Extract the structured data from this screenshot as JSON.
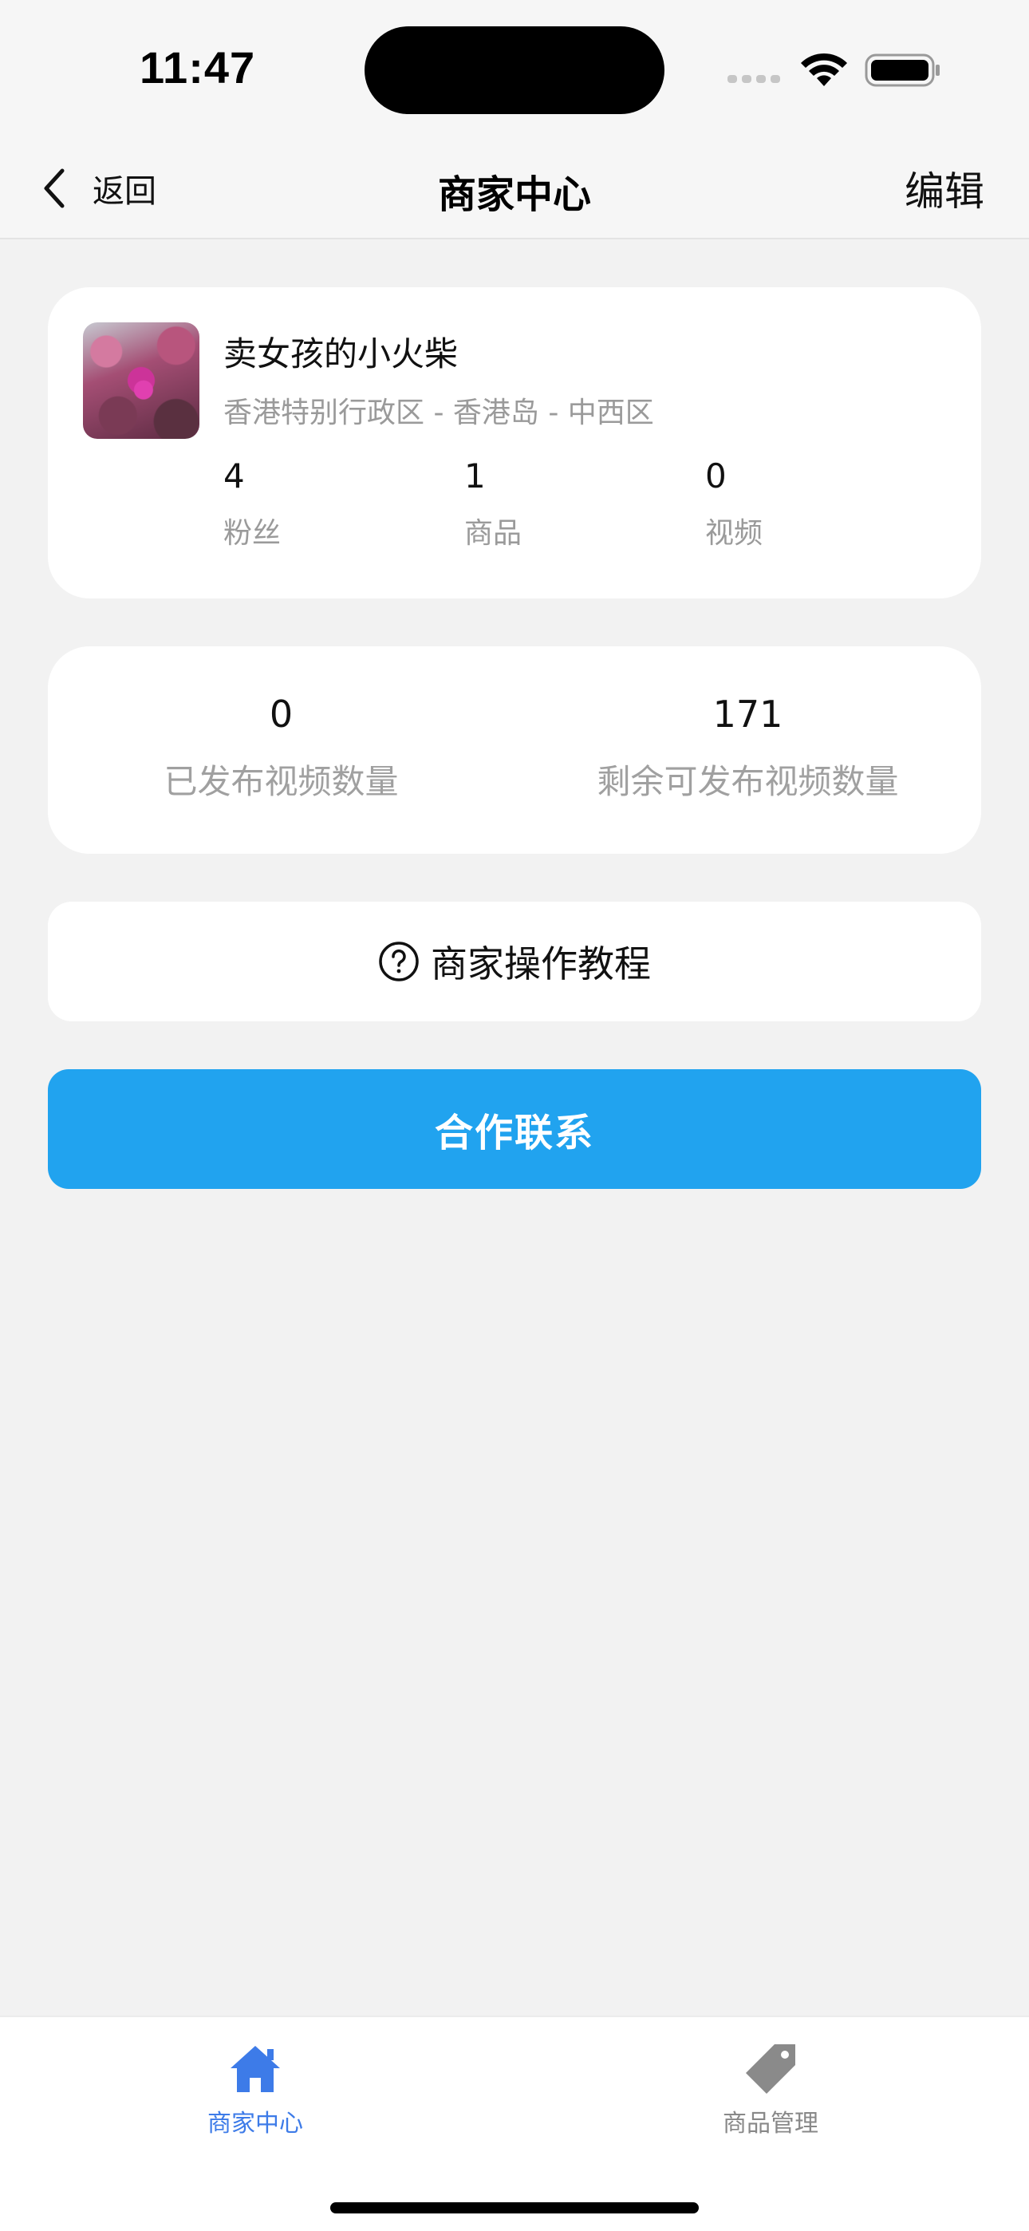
{
  "status_bar": {
    "time": "11:47"
  },
  "nav": {
    "back_label": "返回",
    "title": "商家中心",
    "edit_label": "编辑"
  },
  "profile": {
    "name": "卖女孩的小火柴",
    "location": "香港特别行政区 - 香港岛 - 中西区",
    "stats": [
      {
        "value": "4",
        "label": "粉丝"
      },
      {
        "value": "1",
        "label": "商品"
      },
      {
        "value": "0",
        "label": "视频"
      }
    ]
  },
  "video_quota": {
    "published_value": "0",
    "published_label": "已发布视频数量",
    "remaining_value": "171",
    "remaining_label": "剩余可发布视频数量"
  },
  "tutorial": {
    "label": "商家操作教程",
    "icon": "question-circle-icon"
  },
  "contact": {
    "label": "合作联系",
    "color": "#21a3ef"
  },
  "tab_bar": {
    "tabs": [
      {
        "label": "商家中心",
        "icon": "home-icon",
        "active": true,
        "color": "#3d7be8"
      },
      {
        "label": "商品管理",
        "icon": "tag-icon",
        "active": false,
        "color": "#888888"
      }
    ]
  }
}
